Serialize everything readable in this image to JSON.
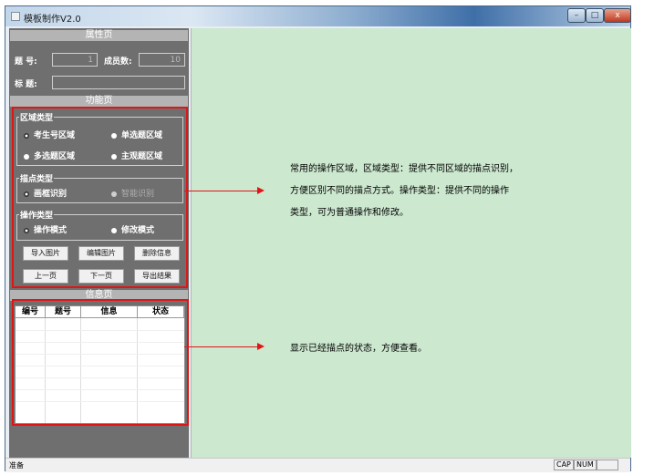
{
  "window": {
    "title": "模板制作V2.0",
    "buttons": {
      "minimize": "–",
      "maximize": "□",
      "close": "x"
    }
  },
  "properties": {
    "section_title": "属性页",
    "question_number_label": "题 号:",
    "question_number_value": "1",
    "members_label": "成员数:",
    "members_value": "10",
    "title_label": "标 题:",
    "title_value": ""
  },
  "functions": {
    "section_title": "功能页",
    "area_type": {
      "label": "区域类型",
      "options": [
        "考生号区域",
        "单选题区域",
        "多选题区域",
        "主观题区域"
      ]
    },
    "anchor_type": {
      "label": "描点类型",
      "options": [
        "画框识别",
        "智能识别"
      ]
    },
    "operation_type": {
      "label": "操作类型",
      "options": [
        "操作模式",
        "修改模式"
      ]
    },
    "buttons": [
      "导入图片",
      "编辑图片",
      "删除信息",
      "上一页",
      "下一页",
      "导出结果"
    ]
  },
  "info": {
    "section_title": "信息页",
    "columns": [
      "编号",
      "题号",
      "信息",
      "状态"
    ]
  },
  "annotations": {
    "functions_note": [
      "常用的操作区域，区域类型：提供不同区域的描点识别，",
      "方便区别不同的描点方式。操作类型：提供不同的操作",
      "类型，可为普通操作和修改。"
    ],
    "info_note": "显示已经描点的状态，方便查看。"
  },
  "status_bar": {
    "text": "准备",
    "indicators": [
      "CAP",
      "NUM"
    ]
  },
  "colors": {
    "panel": "#6f6f6f",
    "main": "#cce8cf",
    "highlight": "#e01515"
  }
}
